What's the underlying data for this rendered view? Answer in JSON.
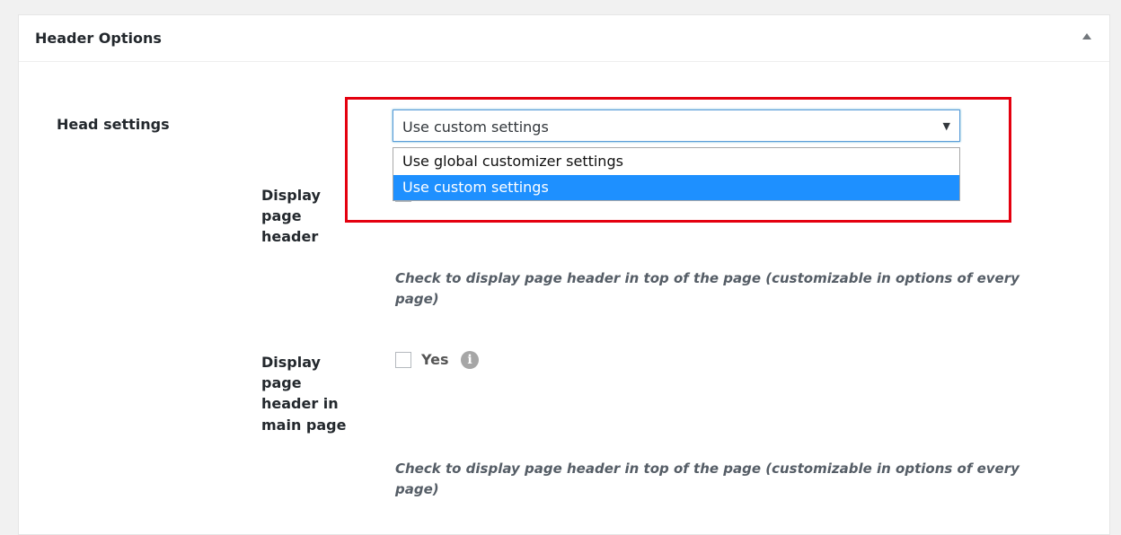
{
  "panel": {
    "title": "Header Options"
  },
  "head_settings": {
    "label": "Head settings",
    "selected_value": "Use custom settings",
    "arrow": "▼",
    "options": [
      "Use global customizer settings",
      "Use custom settings"
    ]
  },
  "display_page_header": {
    "label_lines": [
      "Display",
      "page",
      "header"
    ],
    "description": "Check to display page header in top of the page (customizable in options of every page)"
  },
  "display_page_header_main": {
    "label_lines": [
      "Display",
      "page",
      "header in",
      "main page"
    ],
    "checkbox_label": "Yes",
    "info_glyph": "i",
    "description": "Check to display page header in top of the page (customizable in options of every page)"
  },
  "colors": {
    "highlight_border": "#e4000f",
    "option_selected_bg": "#1e90ff"
  }
}
